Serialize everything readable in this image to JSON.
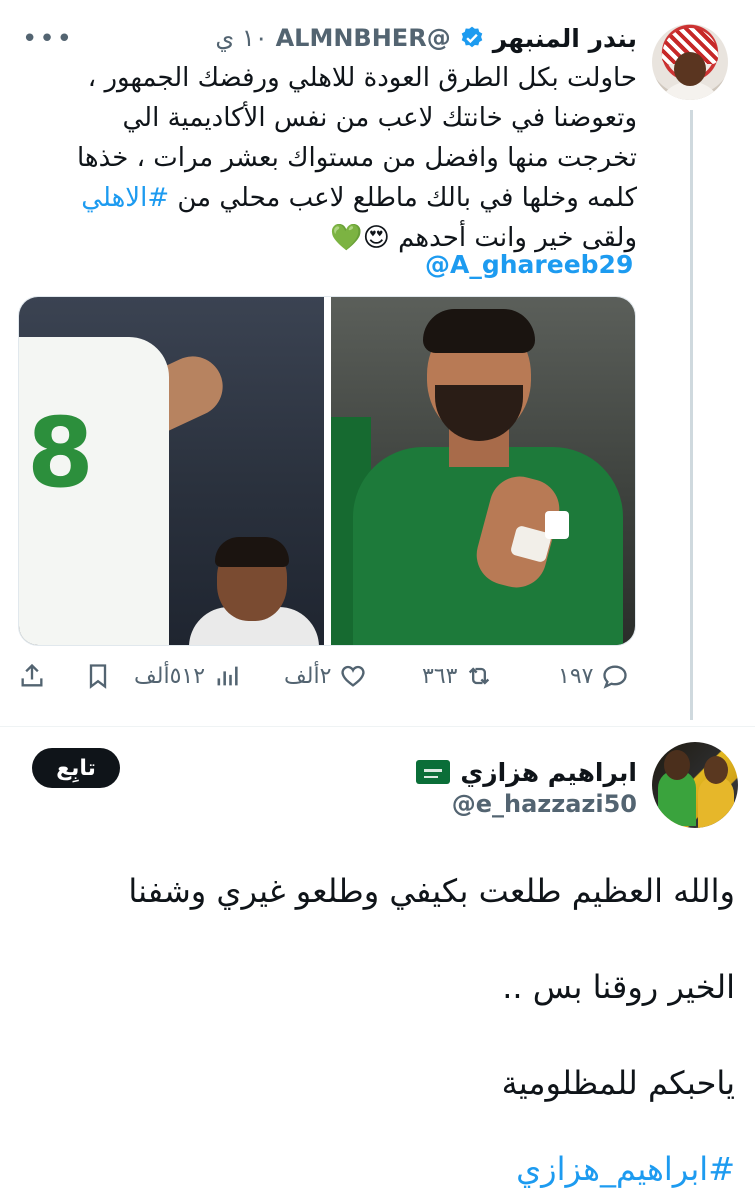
{
  "tweet": {
    "author_name": "بندر المنبهر",
    "handle": "@ALMNBHER",
    "time": "١٠ ي",
    "more_label": "•••",
    "text_lines": [
      "حاولت بكل الطرق العودة للاهلي ورفضك الجمهور ،",
      "وتعوضنا في خانتك لاعب من نفس الأكاديمية الي",
      "تخرجت منها وافضل من مستواك بعشر مرات ، خذها",
      "كلمه وخلها في بالك ماطلع لاعب محلي من",
      "ولقى خير وانت أحدهم 😍💚"
    ],
    "hashtag": "#الاهلي",
    "mention": "@A_ghareeb29",
    "actions": {
      "replies": "١٩٧",
      "retweets": "٣٦٣",
      "likes": "٢ألف",
      "views": "٥١٢ألف"
    }
  },
  "reply": {
    "author_name": "ابراهيم هزازي",
    "handle": "@e_hazzazi50",
    "follow_label": "تابِع",
    "lines": [
      "والله العظيم طلعت بكيفي وطلعو غيري وشفنا",
      "الخير روقنا بس ..",
      "ياحبكم للمظلومية"
    ],
    "hashtag": "#ابراهيم_هزازي"
  },
  "colors": {
    "link": "#1d9bf0",
    "muted": "#536471",
    "verified": "#1d9bf0"
  }
}
